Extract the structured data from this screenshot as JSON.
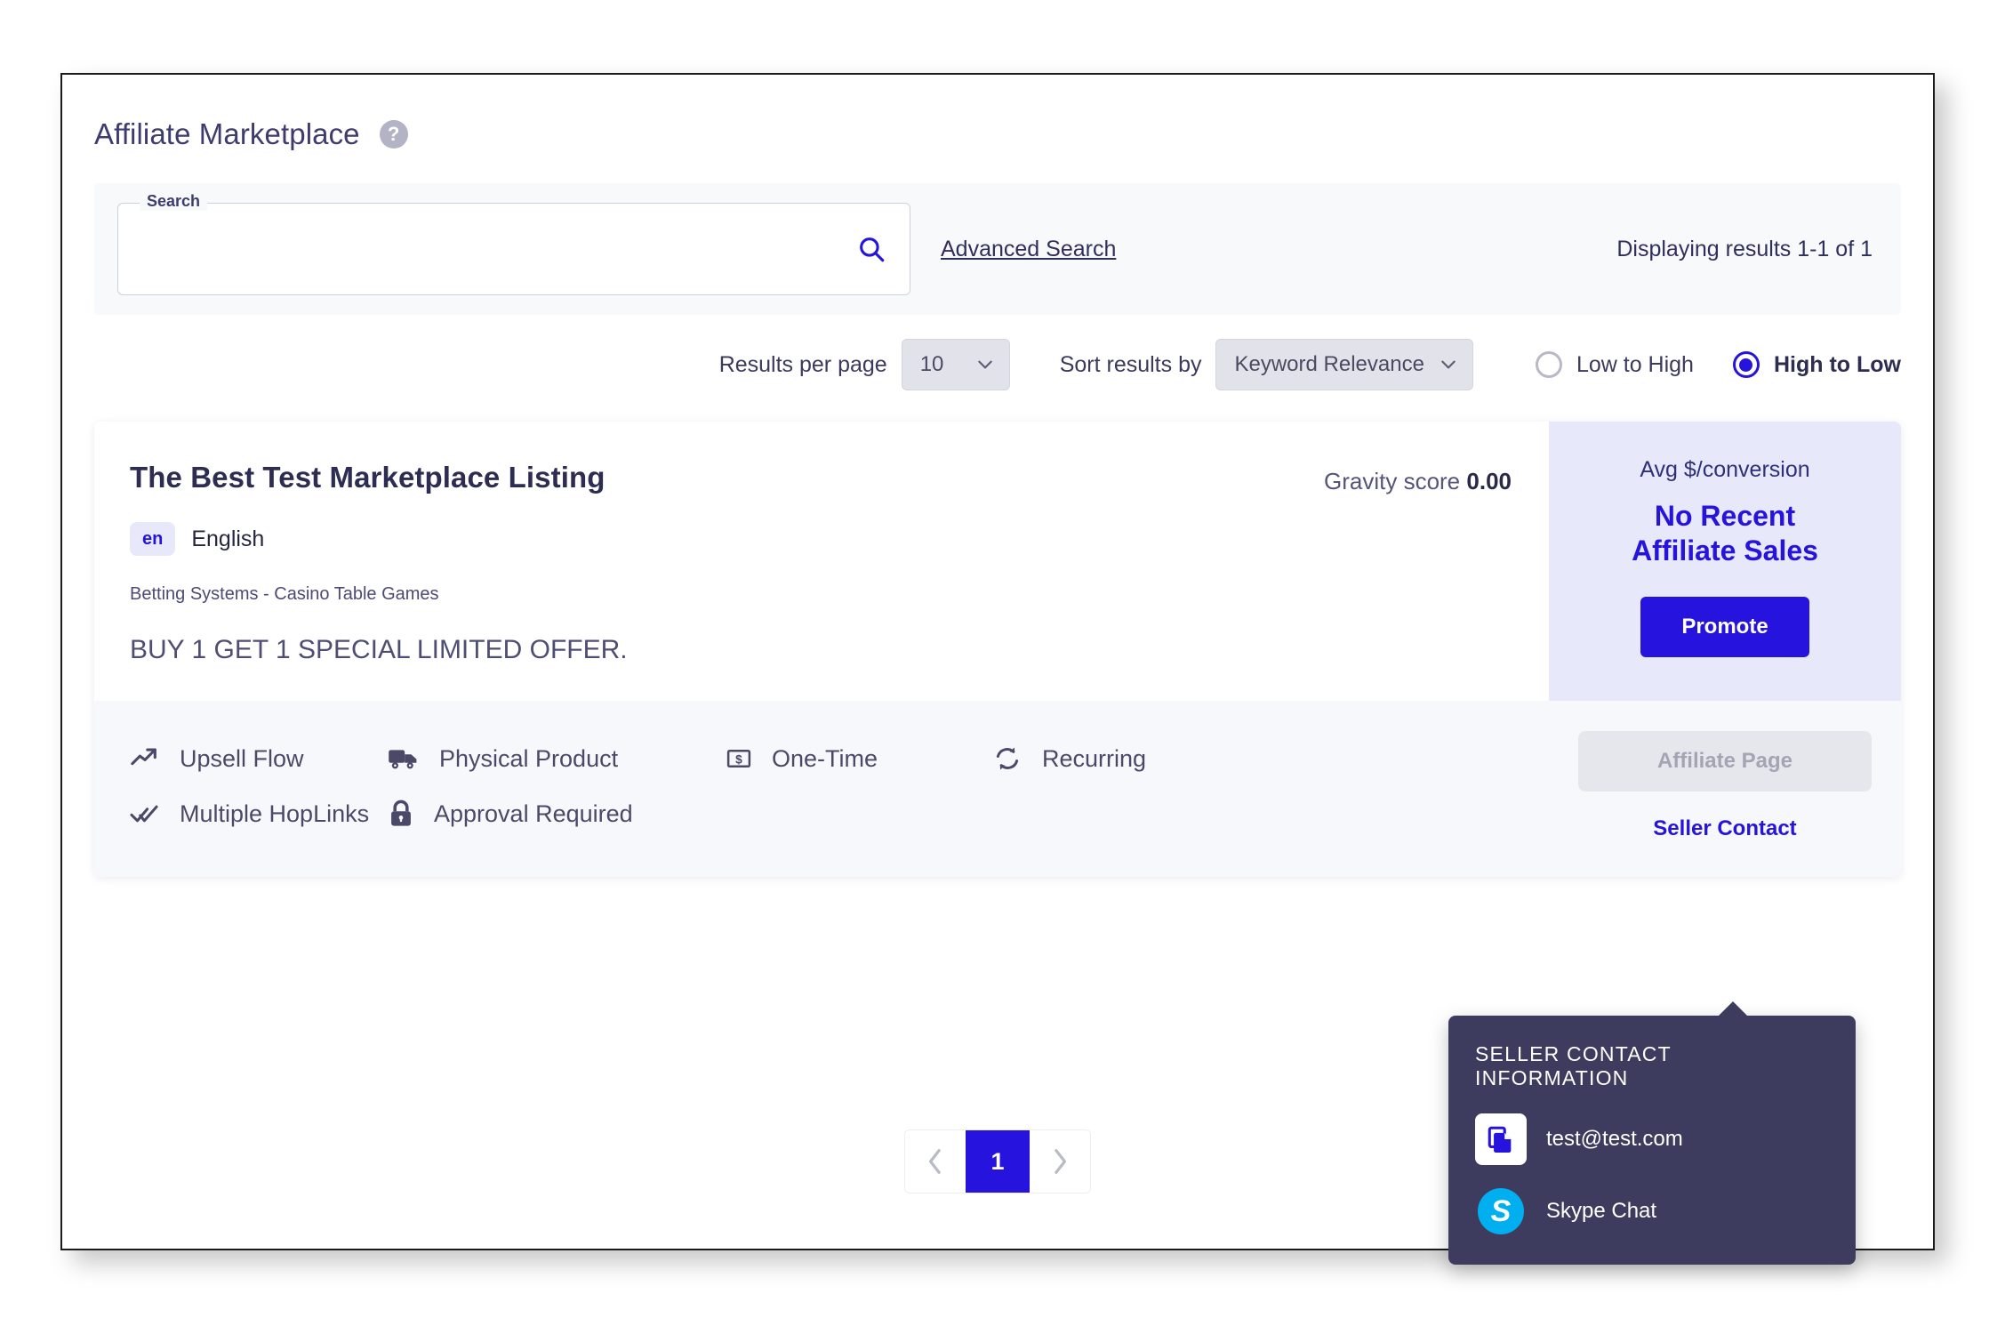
{
  "header": {
    "title": "Affiliate Marketplace",
    "help_icon": "help-circle-icon",
    "help_glyph": "?"
  },
  "search": {
    "legend": "Search",
    "value": "",
    "placeholder": "",
    "icon": "search-icon",
    "advanced_search": "Advanced Search",
    "results_count": "Displaying results 1-1 of 1"
  },
  "controls": {
    "results_per_page_label": "Results per page",
    "results_per_page_value": "10",
    "sort_label": "Sort results by",
    "sort_value": "Keyword Relevance",
    "order_options": [
      {
        "label": "Low to High",
        "selected": false
      },
      {
        "label": "High to Low",
        "selected": true
      }
    ]
  },
  "listing": {
    "title": "The Best Test Marketplace Listing",
    "gravity_label": "Gravity score",
    "gravity_value": "0.00",
    "language_code": "en",
    "language_name": "English",
    "category": "Betting Systems - Casino Table Games",
    "tagline": "BUY 1 GET 1 SPECIAL LIMITED OFFER.",
    "side": {
      "label": "Avg $/conversion",
      "headline_line1": "No Recent",
      "headline_line2": "Affiliate Sales",
      "promote_button": "Promote"
    },
    "features": [
      {
        "label": "Upsell Flow",
        "icon": "trending-up-icon"
      },
      {
        "label": "Physical Product",
        "icon": "truck-icon"
      },
      {
        "label": "One-Time",
        "icon": "money-bill-icon"
      },
      {
        "label": "Recurring",
        "icon": "refresh-cycle-icon"
      },
      {
        "label": "Multiple HopLinks",
        "icon": "double-check-icon"
      },
      {
        "label": "Approval Required",
        "icon": "lock-icon"
      }
    ],
    "affiliate_page_button": "Affiliate Page",
    "seller_contact_link": "Seller Contact"
  },
  "tooltip": {
    "title": "SELLER CONTACT INFORMATION",
    "rows": [
      {
        "label": "test@test.com",
        "icon": "copy-icon"
      },
      {
        "label": "Skype Chat",
        "icon": "skype-icon",
        "glyph": "S"
      }
    ]
  },
  "pagination": {
    "prev_icon": "chevron-left-icon",
    "next_icon": "chevron-right-icon",
    "current_page": "1"
  },
  "colors": {
    "accent": "#2613dd",
    "title": "#3d3c6e",
    "panel_bg": "#f8f9fb",
    "side_bg": "#e7e8fa",
    "tooltip_bg": "#3e3c5e",
    "skype": "#00aff0"
  }
}
